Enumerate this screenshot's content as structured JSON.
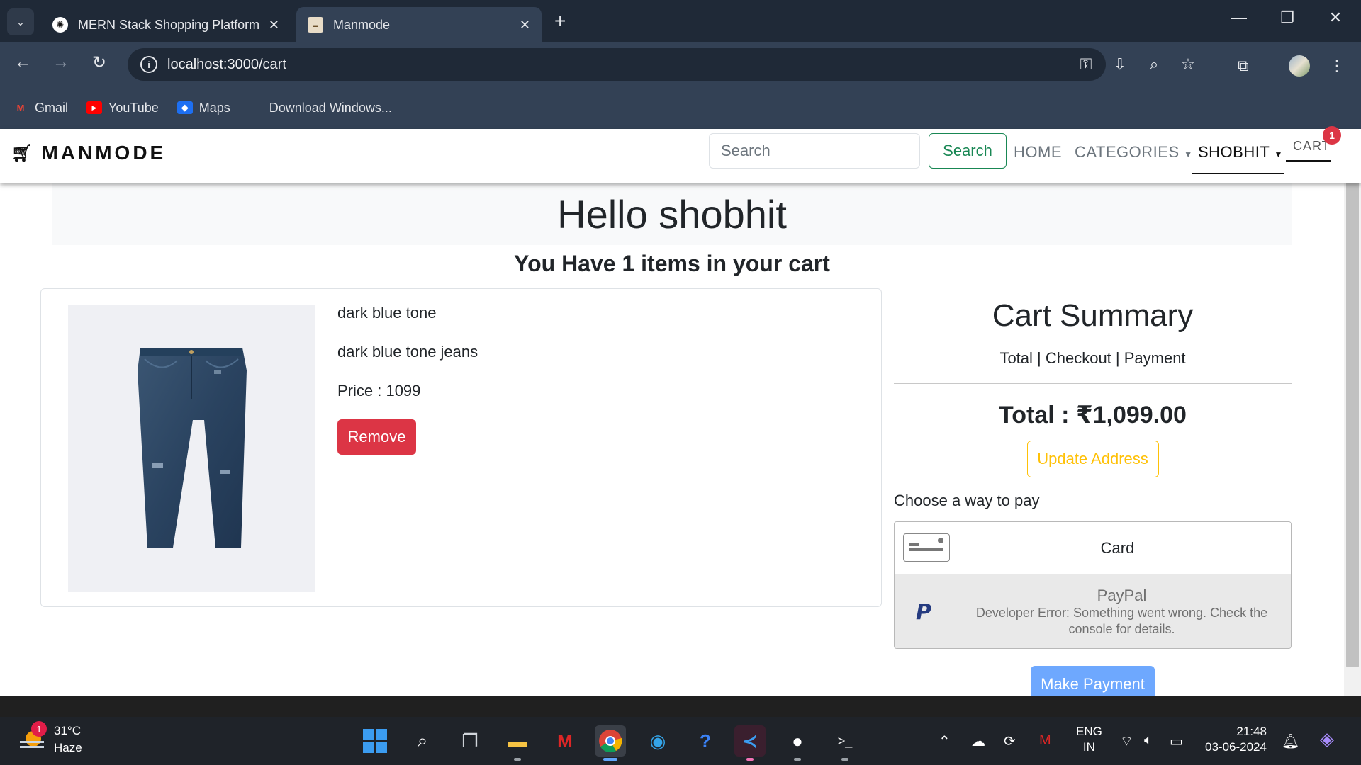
{
  "browser": {
    "tabs": [
      {
        "title": "MERN Stack Shopping Platform",
        "active": false
      },
      {
        "title": "Manmode",
        "active": true
      }
    ],
    "url": "localhost:3000/cart",
    "bookmarks": [
      {
        "label": "Gmail",
        "icon": "gmail-icon"
      },
      {
        "label": "YouTube",
        "icon": "youtube-icon"
      },
      {
        "label": "Maps",
        "icon": "maps-icon"
      },
      {
        "label": "Download Windows...",
        "icon": "windows-icon"
      }
    ]
  },
  "navbar": {
    "brand": "MANMODE",
    "search_placeholder": "Search",
    "search_button": "Search",
    "links": {
      "home": "HOME",
      "categories": "CATEGORIES",
      "user": "SHOBHIT",
      "cart": "CART"
    },
    "cart_count": "1"
  },
  "page": {
    "greeting": "Hello shobhit",
    "items_message": "You Have 1 items in your cart"
  },
  "cart_items": [
    {
      "name": "dark blue tone",
      "description": "dark blue tone jeans",
      "price_text": "Price : 1099",
      "remove_label": "Remove"
    }
  ],
  "summary": {
    "title": "Cart Summary",
    "subtitle": "Total | Checkout | Payment",
    "total": "Total : ₹1,099.00",
    "update_address": "Update Address",
    "choose_pay": "Choose a way to pay",
    "card_label": "Card",
    "paypal_label": "PayPal",
    "paypal_error": "Developer Error: Something went wrong. Check the console for details.",
    "make_payment": "Make Payment"
  },
  "taskbar": {
    "weather_temp": "31°C",
    "weather_desc": "Haze",
    "weather_badge": "1",
    "lang_line1": "ENG",
    "lang_line2": "IN",
    "time": "21:48",
    "date": "03-06-2024"
  },
  "colors": {
    "danger": "#dc3545",
    "success": "#198754",
    "warning": "#ffc107",
    "primary_disabled": "#6ea8fe",
    "chrome_dark": "#1f2937",
    "chrome_mid": "#334155"
  }
}
